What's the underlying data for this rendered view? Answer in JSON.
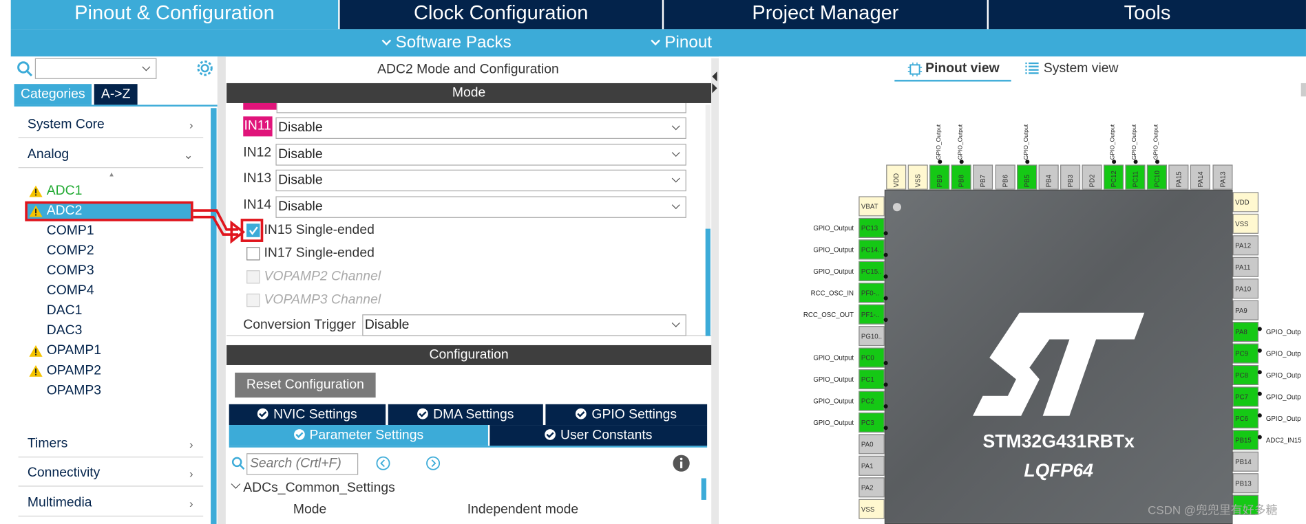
{
  "tabs": [
    {
      "label": "Pinout & Configuration",
      "active": true
    },
    {
      "label": "Clock Configuration",
      "active": false
    },
    {
      "label": "Project Manager",
      "active": false
    },
    {
      "label": "Tools",
      "active": false
    }
  ],
  "subtabs": {
    "software_packs": "Software Packs",
    "pinout": "Pinout"
  },
  "left": {
    "search_value": "",
    "tabs": {
      "categories": "Categories",
      "az": "A->Z"
    },
    "categories": {
      "system_core": "System Core",
      "analog": "Analog",
      "timers": "Timers",
      "connectivity": "Connectivity",
      "multimedia": "Multimedia"
    },
    "analog_items": [
      {
        "label": "ADC1",
        "warning": true,
        "style": "green"
      },
      {
        "label": "ADC2",
        "warning": true,
        "style": "selected"
      },
      {
        "label": "COMP1",
        "warning": false
      },
      {
        "label": "COMP2",
        "warning": false
      },
      {
        "label": "COMP3",
        "warning": false
      },
      {
        "label": "COMP4",
        "warning": false
      },
      {
        "label": "DAC1",
        "warning": false
      },
      {
        "label": "DAC3",
        "warning": false
      },
      {
        "label": "OPAMP1",
        "warning": true
      },
      {
        "label": "OPAMP2",
        "warning": true
      },
      {
        "label": "OPAMP3",
        "warning": false
      }
    ]
  },
  "middle": {
    "title": "ADC2 Mode and Configuration",
    "mode_header": "Mode",
    "mode_rows": [
      {
        "label": "IN11",
        "value": "Disable",
        "highlight": true
      },
      {
        "label": "IN12",
        "value": "Disable"
      },
      {
        "label": "IN13",
        "value": "Disable"
      },
      {
        "label": "IN14",
        "value": "Disable"
      }
    ],
    "checks": [
      {
        "label": "IN15 Single-ended",
        "checked": true,
        "enabled": true
      },
      {
        "label": "IN17 Single-ended",
        "checked": false,
        "enabled": true
      },
      {
        "label": "VOPAMP2 Channel",
        "checked": false,
        "enabled": false
      },
      {
        "label": "VOPAMP3 Channel",
        "checked": false,
        "enabled": false
      }
    ],
    "conversion_trigger": {
      "label": "Conversion Trigger",
      "value": "Disable"
    },
    "config_header": "Configuration",
    "reset_button": "Reset Configuration",
    "settings_tabs": [
      "NVIC Settings",
      "DMA Settings",
      "GPIO Settings"
    ],
    "settings_tabs2": [
      {
        "label": "Parameter Settings",
        "active": true
      },
      {
        "label": "User Constants",
        "active": false
      }
    ],
    "search_placeholder": "Search (Crtl+F)",
    "tree": {
      "group": "ADCs_Common_Settings",
      "param": "Mode",
      "value": "Independent mode"
    }
  },
  "right": {
    "views": {
      "pinout": "Pinout view",
      "system": "System view"
    },
    "chip_name": "STM32G431RBTx",
    "package": "LQFP64",
    "top_pins": [
      {
        "label": "VDD",
        "color": "y",
        "signal": ""
      },
      {
        "label": "VSS",
        "color": "y",
        "signal": ""
      },
      {
        "label": "PB9",
        "color": "g",
        "signal": "GPIO_Output"
      },
      {
        "label": "PB8",
        "color": "g",
        "signal": "GPIO_Output"
      },
      {
        "label": "PB7",
        "color": "gr",
        "signal": ""
      },
      {
        "label": "PB6",
        "color": "gr",
        "signal": ""
      },
      {
        "label": "PB5",
        "color": "g",
        "signal": "GPIO_Output"
      },
      {
        "label": "PB4",
        "color": "gr",
        "signal": ""
      },
      {
        "label": "PB3",
        "color": "gr",
        "signal": ""
      },
      {
        "label": "PD2",
        "color": "gr",
        "signal": ""
      },
      {
        "label": "PC12",
        "color": "g",
        "signal": "GPIO_Output"
      },
      {
        "label": "PC11",
        "color": "g",
        "signal": "GPIO_Output"
      },
      {
        "label": "PC10",
        "color": "g",
        "signal": "GPIO_Output"
      },
      {
        "label": "PA15",
        "color": "gr",
        "signal": ""
      },
      {
        "label": "PA14",
        "color": "gr",
        "signal": ""
      },
      {
        "label": "PA13",
        "color": "gr",
        "signal": ""
      }
    ],
    "left_pins": [
      {
        "label": "VBAT",
        "color": "y",
        "signal": ""
      },
      {
        "label": "PC13",
        "color": "g",
        "signal": "GPIO_Output"
      },
      {
        "label": "PC14..",
        "color": "g",
        "signal": "GPIO_Output"
      },
      {
        "label": "PC15..",
        "color": "g",
        "signal": "GPIO_Output"
      },
      {
        "label": "PF0-..",
        "color": "g",
        "signal": "RCC_OSC_IN"
      },
      {
        "label": "PF1-..",
        "color": "g",
        "signal": "RCC_OSC_OUT"
      },
      {
        "label": "PG10..",
        "color": "gr",
        "signal": ""
      },
      {
        "label": "PC0",
        "color": "g",
        "signal": "GPIO_Output"
      },
      {
        "label": "PC1",
        "color": "g",
        "signal": "GPIO_Output"
      },
      {
        "label": "PC2",
        "color": "g",
        "signal": "GPIO_Output"
      },
      {
        "label": "PC3",
        "color": "g",
        "signal": "GPIO_Output"
      },
      {
        "label": "PA0",
        "color": "gr",
        "signal": ""
      },
      {
        "label": "PA1",
        "color": "gr",
        "signal": ""
      },
      {
        "label": "PA2",
        "color": "gr",
        "signal": ""
      },
      {
        "label": "VSS",
        "color": "y",
        "signal": ""
      }
    ],
    "right_pins": [
      {
        "label": "VDD",
        "color": "y",
        "signal": ""
      },
      {
        "label": "VSS",
        "color": "y",
        "signal": ""
      },
      {
        "label": "PA12",
        "color": "gr",
        "signal": ""
      },
      {
        "label": "PA11",
        "color": "gr",
        "signal": ""
      },
      {
        "label": "PA10",
        "color": "gr",
        "signal": ""
      },
      {
        "label": "PA9",
        "color": "gr",
        "signal": ""
      },
      {
        "label": "PA8",
        "color": "g",
        "signal": "GPIO_Outp"
      },
      {
        "label": "PC9",
        "color": "g",
        "signal": "GPIO_Outp"
      },
      {
        "label": "PC8",
        "color": "g",
        "signal": "GPIO_Outp"
      },
      {
        "label": "PC7",
        "color": "g",
        "signal": "GPIO_Outp"
      },
      {
        "label": "PC6",
        "color": "g",
        "signal": "GPIO_Outp"
      },
      {
        "label": "PB15",
        "color": "g",
        "signal": "ADC2_IN15"
      },
      {
        "label": "PB14",
        "color": "gr",
        "signal": ""
      },
      {
        "label": "PB13",
        "color": "gr",
        "signal": ""
      },
      {
        "label": "",
        "color": "g",
        "signal": ""
      }
    ],
    "watermark": "CSDN @兜兜里有好多糖"
  }
}
